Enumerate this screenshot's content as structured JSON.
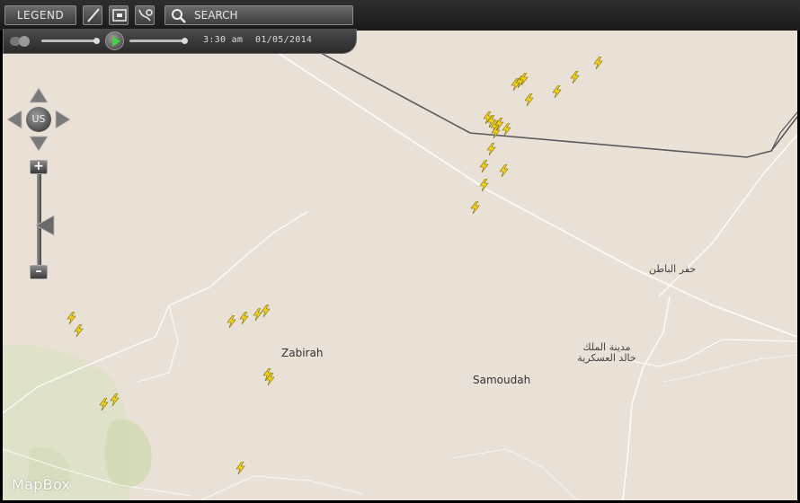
{
  "toolbar": {
    "legend_label": "LEGEND",
    "tools": [
      {
        "name": "draw-tool",
        "icon": "pencil-icon"
      },
      {
        "name": "box-select-tool",
        "icon": "rectangle-icon"
      },
      {
        "name": "route-tool",
        "icon": "route-pin-icon"
      }
    ],
    "search_label": "SEARCH",
    "search_icon": "magnifier-icon"
  },
  "playback": {
    "time": "3:30 am",
    "date": "01/05/2014",
    "play_color": "#3fd43f"
  },
  "navigation": {
    "center_label": "US",
    "zoom_in_label": "+",
    "zoom_out_label": "–"
  },
  "map": {
    "attribution": "MapBox",
    "background_color": "#e9e1d6",
    "places": [
      {
        "name": "Zabirah"
      },
      {
        "name": "Samoudah"
      },
      {
        "name": "حفر الباطن"
      },
      {
        "name": "مدينة الملك خالد العسكرية"
      }
    ],
    "lightning_color": "#f2d21a",
    "lightning_count": 34
  }
}
